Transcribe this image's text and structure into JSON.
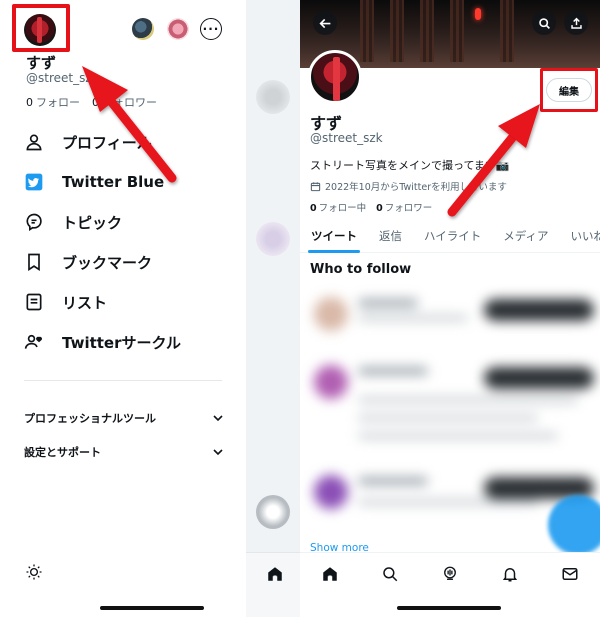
{
  "drawer": {
    "name": "すず",
    "handle": "@street_szk",
    "following_count": "0",
    "following_label": "フォロー",
    "followers_count": "0",
    "followers_label": "フォロワー",
    "menu": [
      {
        "label": "プロフィール",
        "icon": "person-icon"
      },
      {
        "label": "Twitter Blue",
        "icon": "twitter-blue-icon"
      },
      {
        "label": "トピック",
        "icon": "topic-icon"
      },
      {
        "label": "ブックマーク",
        "icon": "bookmark-icon"
      },
      {
        "label": "リスト",
        "icon": "list-icon"
      },
      {
        "label": "Twitterサークル",
        "icon": "circle-icon"
      }
    ],
    "sections": [
      {
        "label": "プロフェッショナルツール"
      },
      {
        "label": "設定とサポート"
      }
    ]
  },
  "profile": {
    "name": "すず",
    "handle": "@street_szk",
    "edit_label": "編集",
    "bio": "ストリート写真をメインで撮ってます📷",
    "joined": "2022年10月からTwitterを利用しています",
    "following_count": "0",
    "following_label": "フォロー中",
    "followers_count": "0",
    "followers_label": "フォロワー",
    "tabs": [
      "ツイート",
      "返信",
      "ハイライト",
      "メディア",
      "いいね"
    ],
    "who_to_follow": "Who to follow",
    "show_more": "Show more"
  },
  "colors": {
    "accent": "#1d9bf0",
    "highlight": "#e6121a"
  }
}
